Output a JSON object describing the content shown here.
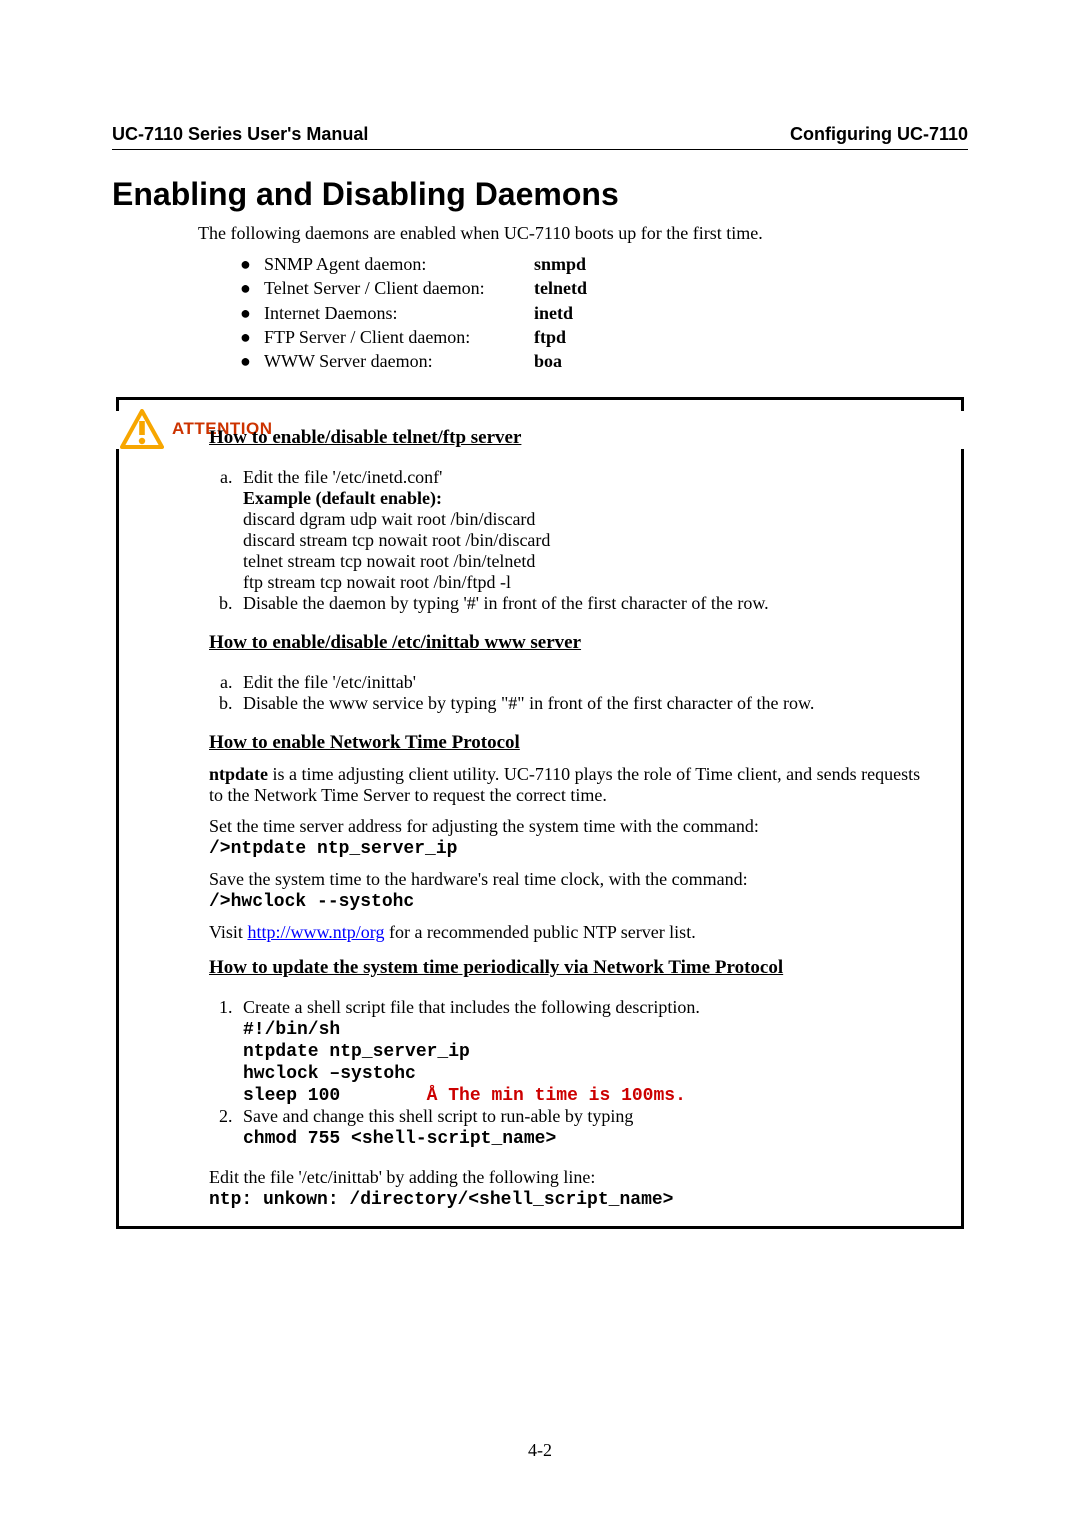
{
  "header": {
    "left": "UC-7110 Series User's Manual",
    "right": "Configuring UC-7110"
  },
  "title": "Enabling and Disabling Daemons",
  "intro": "The following daemons are enabled when UC-7110 boots up for the first time.",
  "daemons": [
    {
      "desc": "SNMP Agent daemon:",
      "name": "snmpd"
    },
    {
      "desc": "Telnet Server / Client daemon:",
      "name": "telnetd"
    },
    {
      "desc": "Internet Daemons:",
      "name": "inetd"
    },
    {
      "desc": "FTP Server / Client daemon:",
      "name": "ftpd"
    },
    {
      "desc": "WWW Server daemon:",
      "name": "boa"
    }
  ],
  "attention": {
    "label": "ATTENTION",
    "sec1": {
      "title": "How to enable/disable telnet/ftp server",
      "a_line1": "Edit the file '/etc/inetd.conf'",
      "a_example_label": "Example (default enable):",
      "a_example_lines": [
        "discard dgram udp wait root /bin/discard",
        "discard stream tcp nowait root /bin/discard",
        "telnet stream tcp nowait root /bin/telnetd",
        "ftp stream tcp nowait root /bin/ftpd -l"
      ],
      "b": "Disable the daemon by typing '#' in front of the first character of the row."
    },
    "sec2": {
      "title": "How to enable/disable /etc/inittab www server",
      "a": "Edit the file '/etc/inittab'",
      "b": "Disable the www service by typing \"#\" in front of the first character of the row."
    },
    "sec3": {
      "title": "How to enable Network Time Protocol",
      "p1_lead_bold": "ntpdate",
      "p1_rest": " is a time adjusting client utility. UC-7110 plays the role of Time client, and sends requests to the Network Time Server to request the correct time.",
      "p2_text": "Set the time server address for adjusting the system time with the command:",
      "cmd1": "/>ntpdate ntp_server_ip",
      "p3_text": "Save the system time to the hardware's real time clock, with the command:",
      "cmd2": "/>hwclock --systohc",
      "p4_pre": "Visit ",
      "p4_link": "http://www.ntp/org",
      "p4_post": " for a recommended public NTP server list."
    },
    "sec4": {
      "title": "How to update the system time periodically via Network Time Protocol",
      "step1_lead": "Create a shell script file that includes the following description.",
      "step1_code_lines": [
        "#!/bin/sh",
        "ntpdate ntp_server_ip",
        "hwclock –systohc"
      ],
      "step1_sleep": "sleep 100        ",
      "step1_sleep_comment": "Å The min time is 100ms.",
      "step2_lead": "Save and change this shell script to run-able by typing",
      "step2_code": "chmod 755 <shell-script_name>",
      "edit_line": "Edit the file '/etc/inittab' by adding the following line:",
      "edit_code": "ntp: unkown: /directory/<shell_script_name>"
    }
  },
  "page_number": "4-2"
}
